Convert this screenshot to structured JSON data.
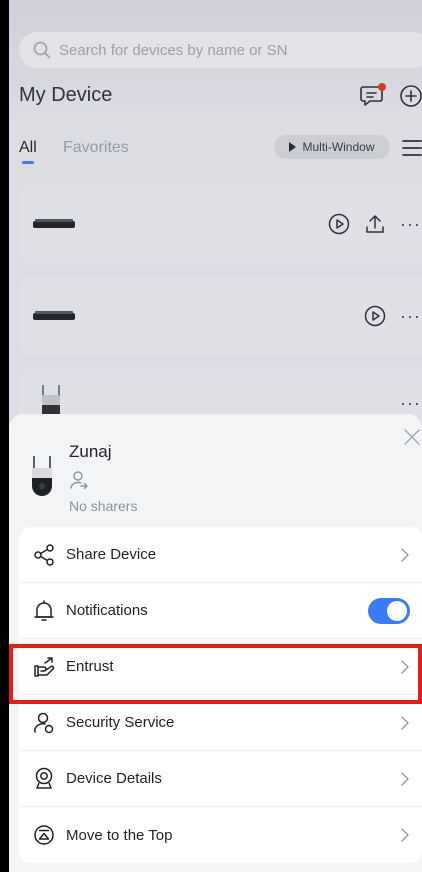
{
  "search": {
    "placeholder": "Search for devices by name or SN"
  },
  "header": {
    "title": "My Device"
  },
  "tabs": [
    {
      "label": "All",
      "active": true
    },
    {
      "label": "Favorites",
      "active": false
    }
  ],
  "multi_window": {
    "label": "Multi-Window"
  },
  "devices_partial": {
    "third_name": "Zunaj"
  },
  "sheet": {
    "device_name": "Zunaj",
    "sharers_text": "No sharers",
    "items": [
      {
        "label": "Share Device",
        "icon": "share-icon",
        "control": "chevron"
      },
      {
        "label": "Notifications",
        "icon": "bell-icon",
        "control": "toggle",
        "toggle_on": true
      },
      {
        "label": "Entrust",
        "icon": "entrust-hand-icon",
        "control": "chevron",
        "highlighted": true
      },
      {
        "label": "Security Service",
        "icon": "security-person-icon",
        "control": "chevron"
      },
      {
        "label": "Device Details",
        "icon": "camera-details-icon",
        "control": "chevron"
      },
      {
        "label": "Move to the Top",
        "icon": "move-top-icon",
        "control": "chevron"
      }
    ]
  },
  "colors": {
    "accent": "#3b7cf5",
    "highlight": "#e0201b",
    "badge": "#e5302a"
  }
}
